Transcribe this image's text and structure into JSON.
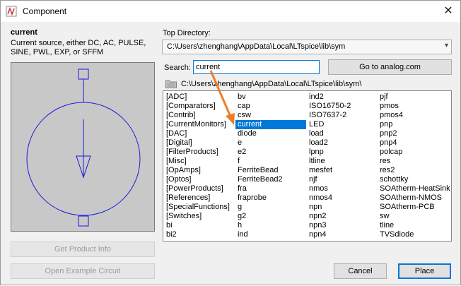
{
  "window": {
    "title": "Component"
  },
  "description": {
    "name": "current",
    "text": "Current source, either DC, AC, PULSE, SINE, PWL, EXP, or SFFM"
  },
  "top_directory": {
    "label": "Top Directory:",
    "value": "C:\\Users\\zhenghang\\AppData\\Local\\LTspice\\lib\\sym"
  },
  "search": {
    "label": "Search:",
    "value": "current"
  },
  "goto_button": "Go to analog.com",
  "current_path": "C:\\Users\\zhenghang\\AppData\\Local\\LTspice\\lib\\sym\\",
  "columns": [
    [
      "[ADC]",
      "[Comparators]",
      "[Contrib]",
      "[CurrentMonitors]",
      "[DAC]",
      "[Digital]",
      "[FilterProducts]",
      "[Misc]",
      "[OpAmps]",
      "[Optos]",
      "[PowerProducts]",
      "[References]",
      "[SpecialFunctions]",
      "[Switches]",
      "bi",
      "bi2"
    ],
    [
      "bv",
      "cap",
      "csw",
      "current",
      "diode",
      "e",
      "e2",
      "f",
      "FerriteBead",
      "FerriteBead2",
      "fra",
      "fraprobe",
      "g",
      "g2",
      "h",
      "ind"
    ],
    [
      "ind2",
      "ISO16750-2",
      "ISO7637-2",
      "LED",
      "load",
      "load2",
      "lpnp",
      "ltline",
      "mesfet",
      "njf",
      "nmos",
      "nmos4",
      "npn",
      "npn2",
      "npn3",
      "npn4"
    ],
    [
      "pjf",
      "pmos",
      "pmos4",
      "pnp",
      "pnp2",
      "pnp4",
      "polcap",
      "res",
      "res2",
      "schottky",
      "SOAtherm-HeatSink",
      "SOAtherm-NMOS",
      "SOAtherm-PCB",
      "sw",
      "tline",
      "TVSdiode"
    ]
  ],
  "selected_item": "current",
  "buttons": {
    "product_info": "Get Product Info",
    "example_circuit": "Open Example Circuit",
    "cancel": "Cancel",
    "place": "Place"
  },
  "colors": {
    "selection": "#0078d7",
    "annotation_arrow": "#ee7d2b",
    "preview_bg": "#c8c8c8"
  },
  "icons": {
    "app": "ltspice-component-icon",
    "close": "close-icon",
    "folder": "folder-icon",
    "dropdown": "chevron-down-icon"
  }
}
